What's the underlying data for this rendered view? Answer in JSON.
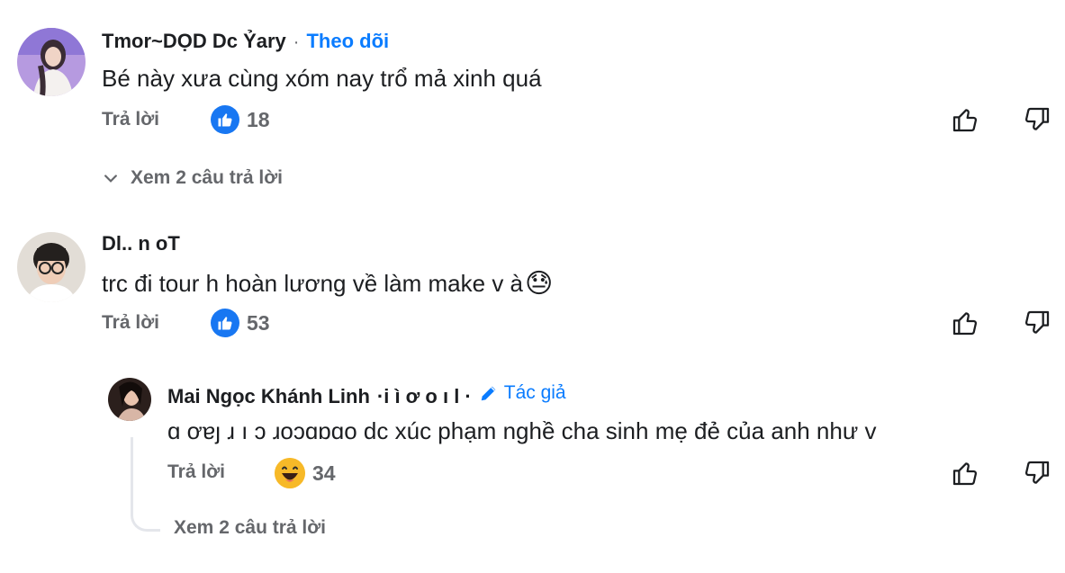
{
  "comments": [
    {
      "author": "Tmor~DỌD Dc Ỷary",
      "follow_sep": "·",
      "follow_label": "Theo dõi",
      "text": "Bé này xưa cùng xóm nay trổ mả xinh quá",
      "reply_label": "Trả lời",
      "reaction": "like-icon",
      "count": "18",
      "view_replies": "Xem 2 câu trả lời"
    },
    {
      "author": "Dl.. n oT",
      "text": "trc đi tour h hoàn lương về làm make v à",
      "emoji": "😓",
      "reply_label": "Trả lời",
      "reaction": "like-icon",
      "count": "53"
    },
    {
      "author": "Mai Ngọc Khánh Linh",
      "author_suffix": "·i ì ơ o ı l ·",
      "badge_label": "Tác giả",
      "text_prefix": "ɑ ơɐȷ ɹ ı ɔ ɹoɔɑɒɑ",
      "text": "o dc xúc phạm nghề cha sinh mẹ đẻ của anh như v",
      "reply_label": "Trả lời",
      "reaction": "haha-icon",
      "count": "34",
      "view_replies": "Xem 2 câu trả lời"
    }
  ],
  "colors": {
    "accent": "#0a7cff",
    "muted": "#65676b",
    "like": "#1877f2",
    "haha": "#f7b928"
  }
}
